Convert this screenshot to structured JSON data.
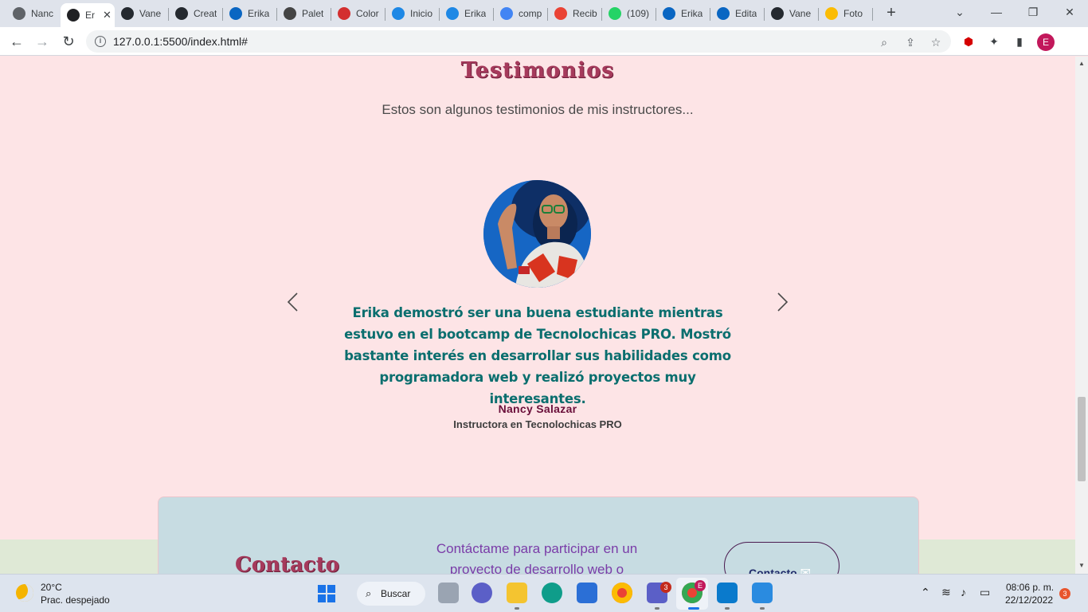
{
  "browser": {
    "tabs": [
      {
        "title": "Nanc",
        "icon": "globe-icon",
        "color": "#5f6368"
      },
      {
        "title": "Er",
        "icon": "globe-icon",
        "color": "#202124",
        "active": true
      },
      {
        "title": "Vane",
        "icon": "github-icon",
        "color": "#24292f"
      },
      {
        "title": "Creat",
        "icon": "github-icon",
        "color": "#24292f"
      },
      {
        "title": "Erika",
        "icon": "linkedin-icon",
        "color": "#0a66c2"
      },
      {
        "title": "Palet",
        "icon": "palette-icon",
        "color": "#444444"
      },
      {
        "title": "Color",
        "icon": "shield-icon",
        "color": "#d32f2f"
      },
      {
        "title": "Inicio",
        "icon": "canva-icon",
        "color": "#1e88e5"
      },
      {
        "title": "Erika",
        "icon": "canva-icon",
        "color": "#1e88e5"
      },
      {
        "title": "comp",
        "icon": "google-icon",
        "color": "#4285f4"
      },
      {
        "title": "Recib",
        "icon": "gmail-icon",
        "color": "#ea4335"
      },
      {
        "title": "(109)",
        "icon": "whatsapp-icon",
        "color": "#25d366"
      },
      {
        "title": "Erika",
        "icon": "linkedin-icon",
        "color": "#0a66c2"
      },
      {
        "title": "Edita",
        "icon": "linkedin-icon",
        "color": "#0a66c2"
      },
      {
        "title": "Vane",
        "icon": "github-icon",
        "color": "#24292f"
      },
      {
        "title": "Foto",
        "icon": "photos-icon",
        "color": "#fbbc04"
      }
    ],
    "url": "127.0.0.1:5500/index.html#"
  },
  "page": {
    "testimonials_title": "Testimonios",
    "testimonials_subtitle": "Estos son algunos testimonios de mis instructores...",
    "quote": "Erika demostró ser una buena estudiante mientras estuvo en el bootcamp de Tecnolochicas PRO. Mostró bastante interés en desarrollar sus habilidades como programadora web y realizó proyectos muy interesantes.",
    "author_name": "Nancy Salazar",
    "author_role": "Instructora en Tecnolochicas PRO",
    "contact_title": "Contacto",
    "contact_text": "Contáctame para participar en un proyecto de desarrollo web o",
    "contact_button": "Contacto",
    "colors": {
      "background": "#fde4e6",
      "accent": "#a63a5c",
      "quote": "#0a6e6e",
      "contact_card": "#c7dce2"
    }
  },
  "taskbar": {
    "temperature": "20°C",
    "weather": "Prac. despejado",
    "search_label": "Buscar",
    "time": "08:06 p. m.",
    "date": "22/12/2022",
    "notifications": "3",
    "teams_badge": "3",
    "chrome_badge": "E"
  }
}
